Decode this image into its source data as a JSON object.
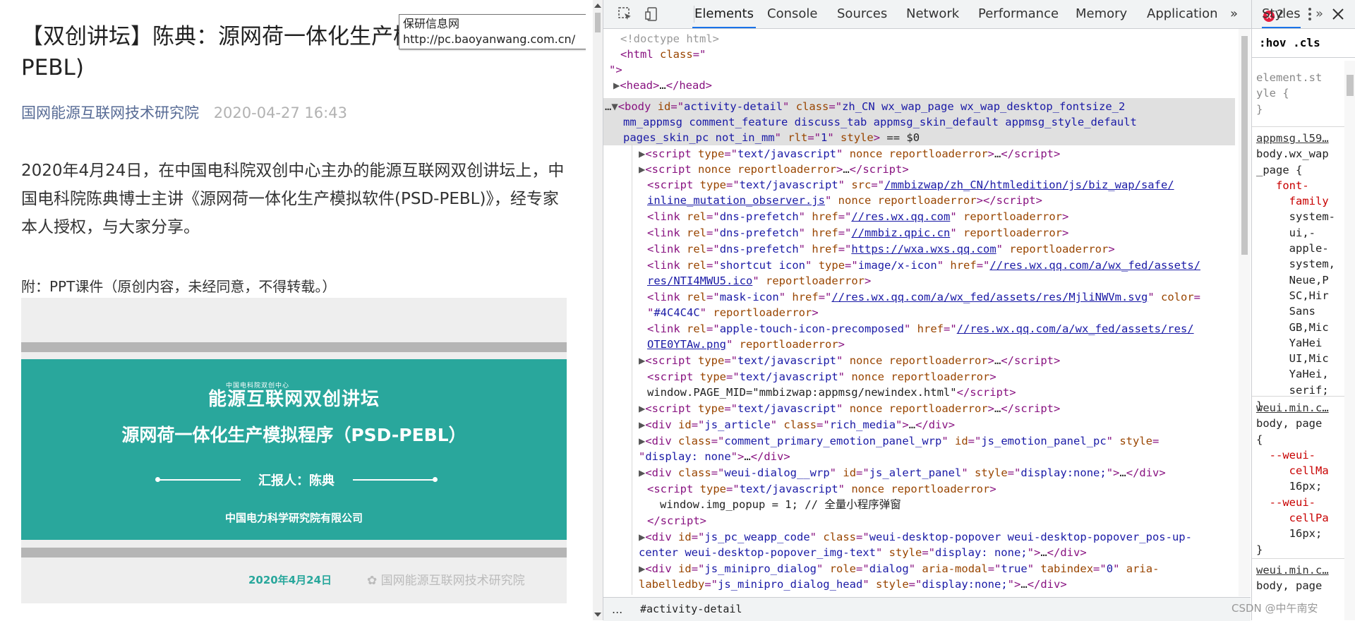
{
  "article": {
    "title": "【双创讲坛】陈典：源网荷一体化生产模拟程序(PSD-PEBL)",
    "author": "国网能源互联网技术研究院",
    "date": "2020-04-27 16:43",
    "body": "2020年4月24日，在中国电科院双创中心主办的能源互联网双创讲坛上，中国电科院陈典博士主讲《源网荷一体化生产模拟软件(PSD-PEBL)》，经专家本人授权，与大家分享。",
    "note": "附：PPT课件（原创内容，未经同意，不得转载。）",
    "slide": {
      "logo_small": "中国电科院双创中心",
      "logo": "能源互联网双创讲坛",
      "title": "源网荷一体化生产模拟程序（PSD-PEBL）",
      "reporter": "汇报人：陈典",
      "company": "中国电力科学研究院有限公司",
      "date": "2020年4月24日",
      "watermark": "国网能源互联网技术研究院"
    }
  },
  "tooltip": {
    "line1": "保研信息网",
    "line2": "http://pc.baoyanwang.com.cn/"
  },
  "devtools": {
    "tabs": [
      "Elements",
      "Console",
      "Sources",
      "Network",
      "Performance",
      "Memory",
      "Application"
    ],
    "more_tabs": "»",
    "error_count": "2",
    "breadcrumb_dots": "...",
    "breadcrumb": "#activity-detail",
    "styles_tab": "Styles",
    "styles_more": "»",
    "styles_filter": ":hov  .cls",
    "watermark": "CSDN @中午南安"
  }
}
